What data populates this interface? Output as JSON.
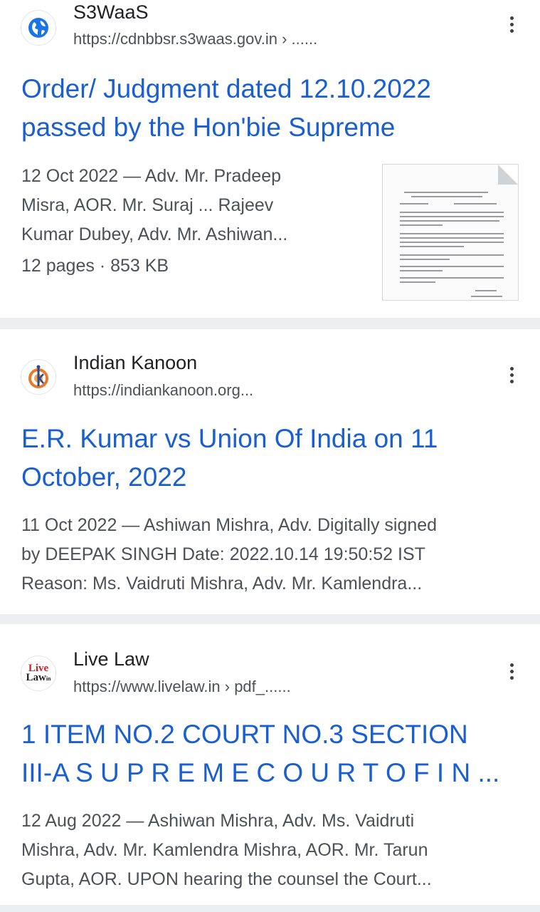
{
  "results": [
    {
      "site_name": "S3WaaS",
      "url": "https://cdnbbsr.s3waas.gov.in › ......",
      "icon": "globe-icon",
      "title_line1": "Order/ Judgment dated 12.10.2022",
      "title_line2": "passed by the Hon'bie Supreme",
      "snippet_line1": "12 Oct 2022 — Adv. Mr. Pradeep",
      "snippet_line2": "Misra, AOR. Mr. Suraj ... Rajeev",
      "snippet_line3": "Kumar Dubey, Adv. Mr. Ashiwan...",
      "meta": "12 pages · 853 KB"
    },
    {
      "site_name": "Indian Kanoon",
      "url": "https://indiankanoon.org...",
      "icon": "indian-kanoon-logo",
      "title_line1": "E.R. Kumar vs Union Of India on 11",
      "title_line2": "October, 2022",
      "snippet_line1": "11 Oct 2022 — Ashiwan Mishra, Adv. Digitally signed",
      "snippet_line2": "by DEEPAK SINGH Date: 2022.10.14 19:50:52 IST",
      "snippet_line3": "Reason: Ms. Vaidruti Mishra, Adv. Mr. Kamlendra..."
    },
    {
      "site_name": "Live Law",
      "url": "https://www.livelaw.in › pdf_......",
      "icon": "live-law-logo",
      "logo_text_1": "Live",
      "logo_text_2": "Law",
      "logo_text_3": "in",
      "title_line1": "1 ITEM NO.2 COURT NO.3 SECTION",
      "title_line2": "III-A S U P R E M E C O U R T O F I N ...",
      "snippet_line1": "12 Aug 2022 — Ashiwan Mishra, Adv. Ms. Vaidruti",
      "snippet_line2": "Mishra, Adv. Mr. Kamlendra Mishra, AOR. Mr. Tarun",
      "snippet_line3": "Gupta, AOR. UPON hearing the counsel the Court..."
    }
  ],
  "colors": {
    "title": "#1a5fd1",
    "snippet": "#4d5156",
    "divider": "#eceef1",
    "globe": "#1a73e8"
  }
}
